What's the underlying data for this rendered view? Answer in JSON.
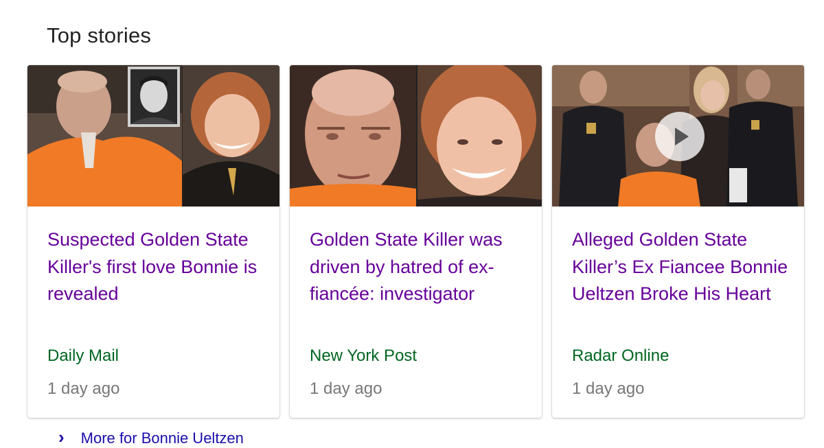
{
  "section": {
    "title": "Top stories"
  },
  "stories": [
    {
      "headline": "Suspected Golden State Killer's first love Bonnie is revealed",
      "source": "Daily Mail",
      "age": "1 day ago",
      "has_video": false
    },
    {
      "headline": "Golden State Killer was driven by hatred of ex-fiancée: investigator",
      "source": "New York Post",
      "age": "1 day ago",
      "has_video": false
    },
    {
      "headline": "Alleged Golden State Killer’s Ex Fiancee Bonnie Ueltzen Broke His Heart",
      "source": "Radar Online",
      "age": "1 day ago",
      "has_video": true
    }
  ],
  "more_link": {
    "label": "More for Bonnie Ueltzen",
    "icon": "arrow-right-icon"
  },
  "colors": {
    "headline": "#660099",
    "source": "#006621",
    "age": "#777777",
    "title": "#222222",
    "link": "#1a0dab"
  }
}
